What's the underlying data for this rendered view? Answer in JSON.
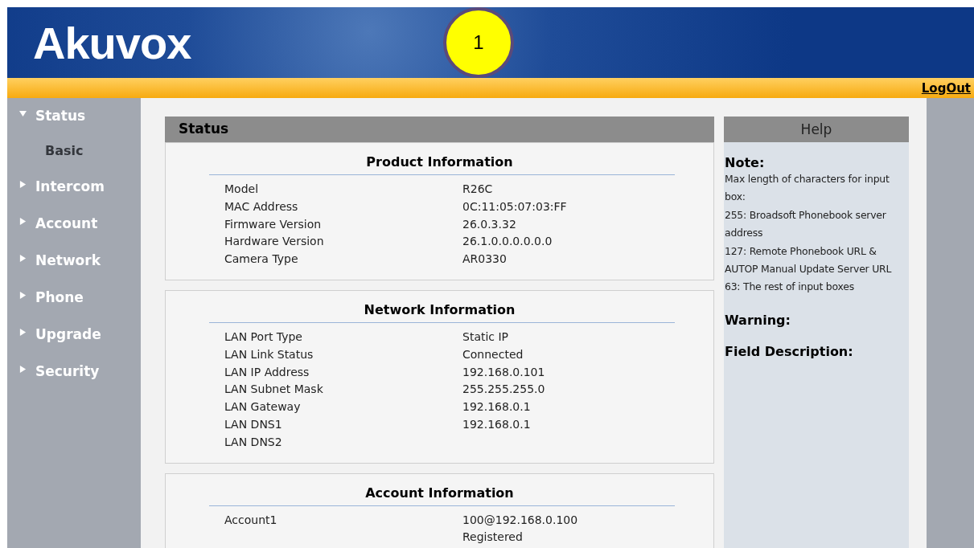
{
  "header": {
    "logo": "Akuvox",
    "callout": "1",
    "logout": "LogOut"
  },
  "sidebar": {
    "items": [
      {
        "label": "Status",
        "expanded": true,
        "children": [
          {
            "label": "Basic",
            "selected": true
          }
        ]
      },
      {
        "label": "Intercom",
        "expanded": false
      },
      {
        "label": "Account",
        "expanded": false
      },
      {
        "label": "Network",
        "expanded": false
      },
      {
        "label": "Phone",
        "expanded": false
      },
      {
        "label": "Upgrade",
        "expanded": false
      },
      {
        "label": "Security",
        "expanded": false
      }
    ]
  },
  "panel": {
    "title": "Status",
    "sections": [
      {
        "title": "Product Information",
        "rows": [
          {
            "label": "Model",
            "value": "R26C"
          },
          {
            "label": "MAC Address",
            "value": "0C:11:05:07:03:FF"
          },
          {
            "label": "Firmware Version",
            "value": "26.0.3.32"
          },
          {
            "label": "Hardware Version",
            "value": "26.1.0.0.0.0.0.0"
          },
          {
            "label": "Camera Type",
            "value": "AR0330"
          }
        ]
      },
      {
        "title": "Network Information",
        "rows": [
          {
            "label": "LAN Port Type",
            "value": "Static IP"
          },
          {
            "label": "LAN Link Status",
            "value": "Connected"
          },
          {
            "label": "LAN IP Address",
            "value": "192.168.0.101"
          },
          {
            "label": "LAN Subnet Mask",
            "value": "255.255.255.0"
          },
          {
            "label": "LAN Gateway",
            "value": "192.168.0.1"
          },
          {
            "label": "LAN DNS1",
            "value": "192.168.0.1"
          },
          {
            "label": "LAN DNS2"
          }
        ]
      },
      {
        "title": "Account Information",
        "rows": [
          {
            "label": "Account1",
            "value": "100@192.168.0.100"
          },
          {
            "value": "Registered"
          }
        ]
      }
    ]
  },
  "help": {
    "title": "Help",
    "blocks": [
      {
        "heading": "Note:",
        "text": "Max length of characters for input box:\n255: Broadsoft Phonebook server address\n127: Remote Phonebook URL & AUTOP Manual Update Server URL\n63: The rest of input boxes"
      },
      {
        "heading": "Warning:"
      },
      {
        "heading": "Field Description:"
      }
    ]
  }
}
